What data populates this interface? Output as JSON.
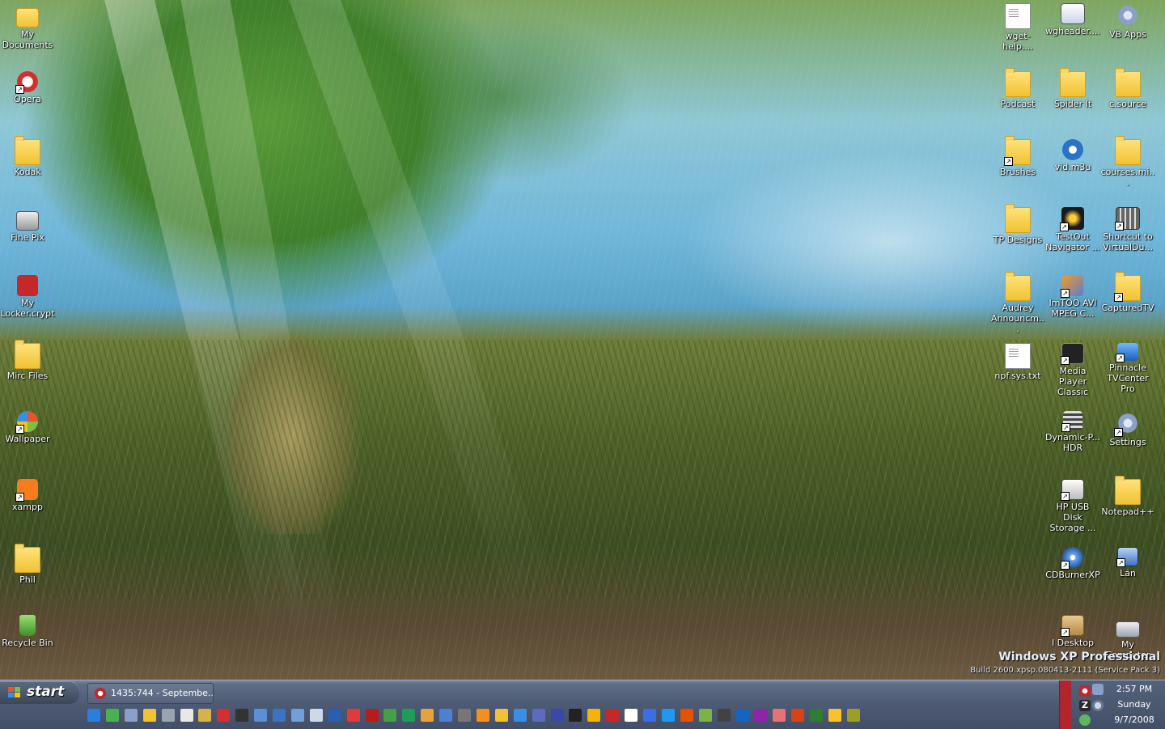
{
  "desktop": {
    "icons_left": [
      {
        "label": "My Documents",
        "kind": "mydocs",
        "shortcut": false
      },
      {
        "label": "Opera",
        "kind": "opera",
        "shortcut": true
      },
      {
        "label": "Kodak",
        "kind": "folder",
        "shortcut": false
      },
      {
        "label": "Fine Pix",
        "kind": "camera",
        "shortcut": false
      },
      {
        "label": "My Locker.crypt",
        "kind": "locker",
        "shortcut": false
      },
      {
        "label": "Mirc Files",
        "kind": "folder",
        "shortcut": false
      },
      {
        "label": "Wallpaper",
        "kind": "wallpaper",
        "shortcut": true
      },
      {
        "label": "xampp",
        "kind": "xampp",
        "shortcut": true
      },
      {
        "label": "Phil",
        "kind": "folder",
        "shortcut": false
      },
      {
        "label": "Recycle Bin",
        "kind": "recycle",
        "shortcut": false
      }
    ],
    "icons_right": [
      [
        {
          "label": "wget-help....",
          "kind": "doc",
          "shortcut": false
        },
        {
          "label": "wgheader....",
          "kind": "app",
          "shortcut": false
        },
        {
          "label": "VB Apps",
          "kind": "gear",
          "shortcut": false
        }
      ],
      [
        {
          "label": "Podcast",
          "kind": "folder",
          "shortcut": false
        },
        {
          "label": "Spider It",
          "kind": "folder",
          "shortcut": false
        },
        {
          "label": "c.source",
          "kind": "folder",
          "shortcut": false
        }
      ],
      [
        {
          "label": "Brushes",
          "kind": "folder",
          "shortcut": true
        },
        {
          "label": "vid.m3u",
          "kind": "media",
          "shortcut": false
        },
        {
          "label": "courses.mi...",
          "kind": "folder",
          "shortcut": false
        }
      ],
      [
        {
          "label": "TP Designs",
          "kind": "folder",
          "shortcut": false
        },
        {
          "label": "TestOut Navigator ...",
          "kind": "testout",
          "shortcut": true
        },
        {
          "label": "Shortcut to VirtualDu...",
          "kind": "film",
          "shortcut": true
        }
      ],
      [
        {
          "label": "Audrey Announcm...",
          "kind": "folder",
          "shortcut": false
        },
        {
          "label": "ImTOO AVI MPEG C...",
          "kind": "imtoo",
          "shortcut": true
        },
        {
          "label": "CapturedTV",
          "kind": "folder",
          "shortcut": true
        }
      ],
      [
        {
          "label": "npf.sys.txt",
          "kind": "doc",
          "shortcut": false
        },
        {
          "label": "Media Player Classic",
          "kind": "mpc",
          "shortcut": true
        },
        {
          "label": "Pinnacle TVCenter Pro",
          "kind": "pinnacle",
          "shortcut": true
        }
      ],
      [
        null,
        {
          "label": "Dynamic-P... HDR",
          "kind": "hdr",
          "shortcut": true
        },
        {
          "label": "Settings",
          "kind": "gear",
          "shortcut": true
        }
      ],
      [
        null,
        {
          "label": "HP USB Disk Storage ...",
          "kind": "hpusb",
          "shortcut": true
        },
        {
          "label": "Notepad++",
          "kind": "folder",
          "shortcut": false
        }
      ],
      [
        null,
        {
          "label": "CDBurnerXP",
          "kind": "cdburner",
          "shortcut": true
        },
        {
          "label": "Lan",
          "kind": "lan",
          "shortcut": true
        }
      ],
      [
        null,
        {
          "label": "I Desktop",
          "kind": "box",
          "shortcut": true
        },
        {
          "label": "My Computer",
          "kind": "computer",
          "shortcut": false
        }
      ]
    ],
    "watermark": {
      "title": "Windows XP Professional",
      "build": "Build 2600.xpsp.080413-2111 (Service Pack 3)"
    }
  },
  "taskbar": {
    "start_label": "start",
    "task_item": "1435:744 - Septembe...",
    "quick_launch": [
      "ie-icon",
      "green-man-icon",
      "send-icon",
      "folder-open-icon",
      "gear-icon",
      "doc-icon",
      "mask-icon",
      "opera-icon",
      "cmd-icon",
      "imgview-icon",
      "vb-icon",
      "network-icon",
      "notepad-icon",
      "monitor-icon",
      "chrome-icon",
      "record-icon",
      "frog-icon",
      "green-dot-icon",
      "bird-icon",
      "doc-blue-icon",
      "grid-icon",
      "firefox-brand-icon",
      "folder-icon",
      "play-icon",
      "bars-icon",
      "chart-icon",
      "zonealarm-icon",
      "flame-icon",
      "opera-red-icon",
      "pen-icon",
      "gear-blue-icon",
      "search-icon",
      "firefox-icon",
      "winamp-icon",
      "mailbox-icon",
      "globe-icon",
      "bird-blue-icon",
      "flower-icon",
      "filezilla-icon",
      "excel-icon",
      "puzzle-icon",
      "window-icon"
    ],
    "tray": {
      "time": "2:57 PM",
      "day": "Sunday",
      "date": "9/7/2008"
    }
  }
}
